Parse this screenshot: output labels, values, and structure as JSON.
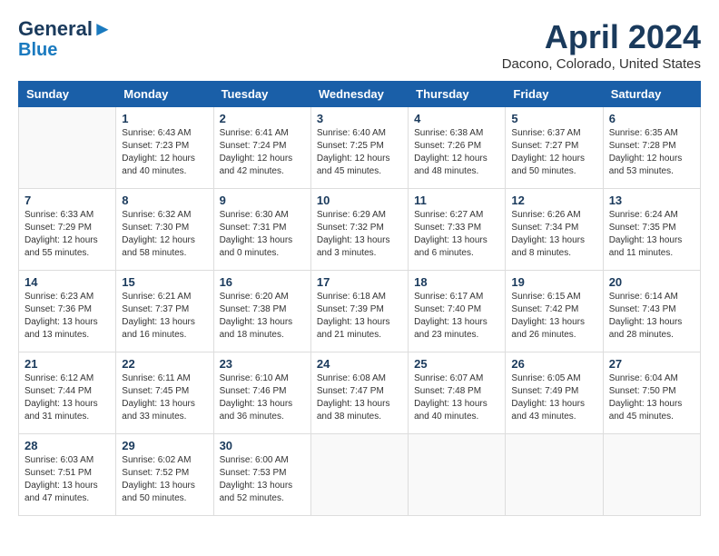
{
  "header": {
    "logo_line1": "General",
    "logo_line2": "Blue",
    "month": "April 2024",
    "location": "Dacono, Colorado, United States"
  },
  "weekdays": [
    "Sunday",
    "Monday",
    "Tuesday",
    "Wednesday",
    "Thursday",
    "Friday",
    "Saturday"
  ],
  "weeks": [
    [
      {
        "day": "",
        "info": ""
      },
      {
        "day": "1",
        "info": "Sunrise: 6:43 AM\nSunset: 7:23 PM\nDaylight: 12 hours\nand 40 minutes."
      },
      {
        "day": "2",
        "info": "Sunrise: 6:41 AM\nSunset: 7:24 PM\nDaylight: 12 hours\nand 42 minutes."
      },
      {
        "day": "3",
        "info": "Sunrise: 6:40 AM\nSunset: 7:25 PM\nDaylight: 12 hours\nand 45 minutes."
      },
      {
        "day": "4",
        "info": "Sunrise: 6:38 AM\nSunset: 7:26 PM\nDaylight: 12 hours\nand 48 minutes."
      },
      {
        "day": "5",
        "info": "Sunrise: 6:37 AM\nSunset: 7:27 PM\nDaylight: 12 hours\nand 50 minutes."
      },
      {
        "day": "6",
        "info": "Sunrise: 6:35 AM\nSunset: 7:28 PM\nDaylight: 12 hours\nand 53 minutes."
      }
    ],
    [
      {
        "day": "7",
        "info": "Sunrise: 6:33 AM\nSunset: 7:29 PM\nDaylight: 12 hours\nand 55 minutes."
      },
      {
        "day": "8",
        "info": "Sunrise: 6:32 AM\nSunset: 7:30 PM\nDaylight: 12 hours\nand 58 minutes."
      },
      {
        "day": "9",
        "info": "Sunrise: 6:30 AM\nSunset: 7:31 PM\nDaylight: 13 hours\nand 0 minutes."
      },
      {
        "day": "10",
        "info": "Sunrise: 6:29 AM\nSunset: 7:32 PM\nDaylight: 13 hours\nand 3 minutes."
      },
      {
        "day": "11",
        "info": "Sunrise: 6:27 AM\nSunset: 7:33 PM\nDaylight: 13 hours\nand 6 minutes."
      },
      {
        "day": "12",
        "info": "Sunrise: 6:26 AM\nSunset: 7:34 PM\nDaylight: 13 hours\nand 8 minutes."
      },
      {
        "day": "13",
        "info": "Sunrise: 6:24 AM\nSunset: 7:35 PM\nDaylight: 13 hours\nand 11 minutes."
      }
    ],
    [
      {
        "day": "14",
        "info": "Sunrise: 6:23 AM\nSunset: 7:36 PM\nDaylight: 13 hours\nand 13 minutes."
      },
      {
        "day": "15",
        "info": "Sunrise: 6:21 AM\nSunset: 7:37 PM\nDaylight: 13 hours\nand 16 minutes."
      },
      {
        "day": "16",
        "info": "Sunrise: 6:20 AM\nSunset: 7:38 PM\nDaylight: 13 hours\nand 18 minutes."
      },
      {
        "day": "17",
        "info": "Sunrise: 6:18 AM\nSunset: 7:39 PM\nDaylight: 13 hours\nand 21 minutes."
      },
      {
        "day": "18",
        "info": "Sunrise: 6:17 AM\nSunset: 7:40 PM\nDaylight: 13 hours\nand 23 minutes."
      },
      {
        "day": "19",
        "info": "Sunrise: 6:15 AM\nSunset: 7:42 PM\nDaylight: 13 hours\nand 26 minutes."
      },
      {
        "day": "20",
        "info": "Sunrise: 6:14 AM\nSunset: 7:43 PM\nDaylight: 13 hours\nand 28 minutes."
      }
    ],
    [
      {
        "day": "21",
        "info": "Sunrise: 6:12 AM\nSunset: 7:44 PM\nDaylight: 13 hours\nand 31 minutes."
      },
      {
        "day": "22",
        "info": "Sunrise: 6:11 AM\nSunset: 7:45 PM\nDaylight: 13 hours\nand 33 minutes."
      },
      {
        "day": "23",
        "info": "Sunrise: 6:10 AM\nSunset: 7:46 PM\nDaylight: 13 hours\nand 36 minutes."
      },
      {
        "day": "24",
        "info": "Sunrise: 6:08 AM\nSunset: 7:47 PM\nDaylight: 13 hours\nand 38 minutes."
      },
      {
        "day": "25",
        "info": "Sunrise: 6:07 AM\nSunset: 7:48 PM\nDaylight: 13 hours\nand 40 minutes."
      },
      {
        "day": "26",
        "info": "Sunrise: 6:05 AM\nSunset: 7:49 PM\nDaylight: 13 hours\nand 43 minutes."
      },
      {
        "day": "27",
        "info": "Sunrise: 6:04 AM\nSunset: 7:50 PM\nDaylight: 13 hours\nand 45 minutes."
      }
    ],
    [
      {
        "day": "28",
        "info": "Sunrise: 6:03 AM\nSunset: 7:51 PM\nDaylight: 13 hours\nand 47 minutes."
      },
      {
        "day": "29",
        "info": "Sunrise: 6:02 AM\nSunset: 7:52 PM\nDaylight: 13 hours\nand 50 minutes."
      },
      {
        "day": "30",
        "info": "Sunrise: 6:00 AM\nSunset: 7:53 PM\nDaylight: 13 hours\nand 52 minutes."
      },
      {
        "day": "",
        "info": ""
      },
      {
        "day": "",
        "info": ""
      },
      {
        "day": "",
        "info": ""
      },
      {
        "day": "",
        "info": ""
      }
    ]
  ]
}
